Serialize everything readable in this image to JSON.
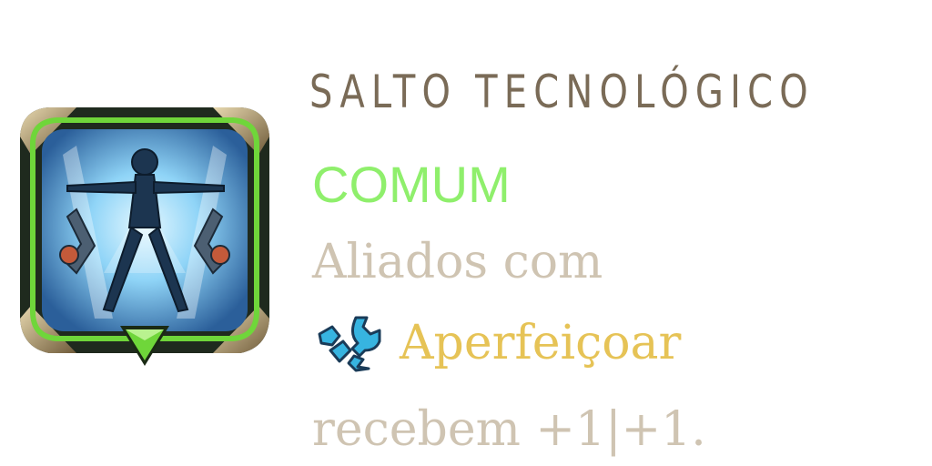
{
  "augment": {
    "title": "SALTO TECNOLÓGICO",
    "rarity": "COMUM",
    "desc_line1": "Aliados com",
    "trait_icon": "wrench-gear-icon",
    "trait_name": "Aperfeiçoar",
    "desc_line3": "recebem +1|+1."
  },
  "colors": {
    "title": "#7a6b57",
    "rarity": "#8fef6c",
    "description": "#cfc4b2",
    "trait": "#e6c356",
    "trait_icon": "#37b4e0",
    "frame_green": "#6fd63a"
  }
}
